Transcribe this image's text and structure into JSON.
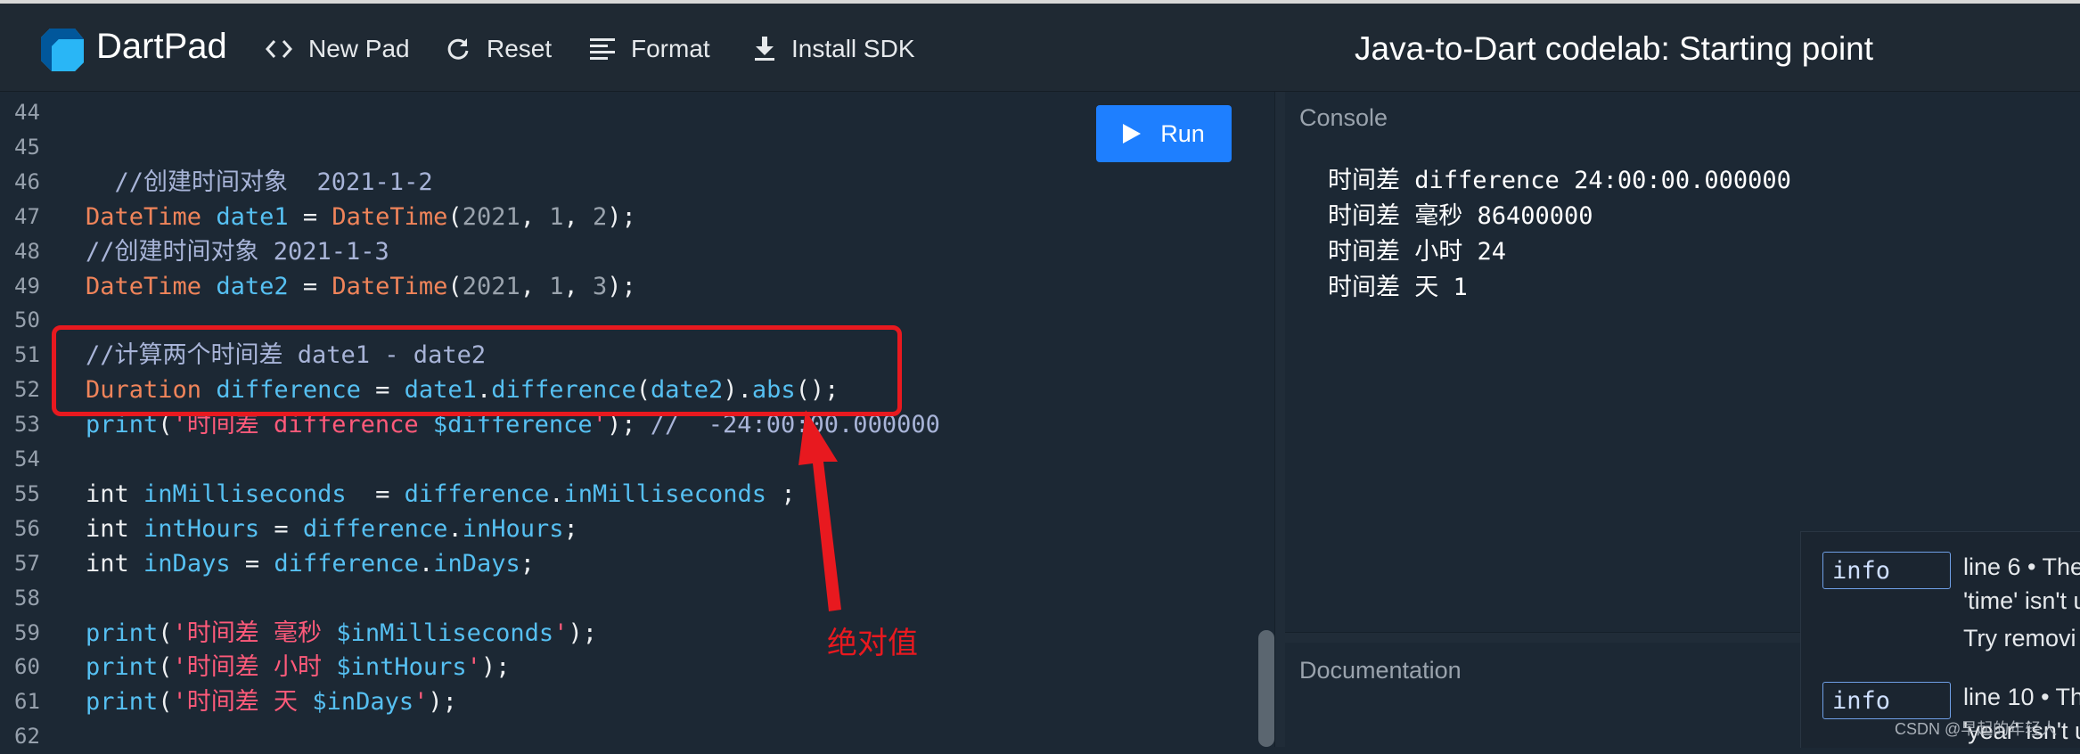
{
  "header": {
    "brand": "DartPad",
    "new_pad_label": "New Pad",
    "reset_label": "Reset",
    "format_label": "Format",
    "install_sdk_label": "Install SDK",
    "pad_title": "Java-to-Dart codelab: Starting point"
  },
  "editor": {
    "run_label": "Run",
    "line_numbers": [
      "44",
      "45",
      "46",
      "47",
      "48",
      "49",
      "50",
      "51",
      "52",
      "53",
      "54",
      "55",
      "56",
      "57",
      "58",
      "59",
      "60",
      "61",
      "62"
    ],
    "lines": [
      [],
      [],
      [
        {
          "t": "  //创建时间对象  2021-1-2",
          "c": "cmt"
        }
      ],
      [
        {
          "t": "DateTime",
          "c": "type"
        },
        {
          "t": " ",
          "c": "plain"
        },
        {
          "t": "date1",
          "c": "ident"
        },
        {
          "t": " = ",
          "c": "plain"
        },
        {
          "t": "DateTime",
          "c": "type"
        },
        {
          "t": "(",
          "c": "plain"
        },
        {
          "t": "2021",
          "c": "num"
        },
        {
          "t": ", ",
          "c": "plain"
        },
        {
          "t": "1",
          "c": "num"
        },
        {
          "t": ", ",
          "c": "plain"
        },
        {
          "t": "2",
          "c": "num"
        },
        {
          "t": ");",
          "c": "plain"
        }
      ],
      [
        {
          "t": "//创建时间对象 2021-1-3",
          "c": "cmt"
        }
      ],
      [
        {
          "t": "DateTime",
          "c": "type"
        },
        {
          "t": " ",
          "c": "plain"
        },
        {
          "t": "date2",
          "c": "ident"
        },
        {
          "t": " = ",
          "c": "plain"
        },
        {
          "t": "DateTime",
          "c": "type"
        },
        {
          "t": "(",
          "c": "plain"
        },
        {
          "t": "2021",
          "c": "num"
        },
        {
          "t": ", ",
          "c": "plain"
        },
        {
          "t": "1",
          "c": "num"
        },
        {
          "t": ", ",
          "c": "plain"
        },
        {
          "t": "3",
          "c": "num"
        },
        {
          "t": ");",
          "c": "plain"
        }
      ],
      [],
      [
        {
          "t": "//计算两个时间差 date1 - date2",
          "c": "cmt"
        }
      ],
      [
        {
          "t": "Duration",
          "c": "type"
        },
        {
          "t": " ",
          "c": "plain"
        },
        {
          "t": "difference",
          "c": "ident"
        },
        {
          "t": " = ",
          "c": "plain"
        },
        {
          "t": "date1",
          "c": "ident"
        },
        {
          "t": ".",
          "c": "plain"
        },
        {
          "t": "difference",
          "c": "ident"
        },
        {
          "t": "(",
          "c": "plain"
        },
        {
          "t": "date2",
          "c": "ident"
        },
        {
          "t": ").",
          "c": "plain"
        },
        {
          "t": "abs",
          "c": "ident"
        },
        {
          "t": "();",
          "c": "plain"
        }
      ],
      [
        {
          "t": "print",
          "c": "ident"
        },
        {
          "t": "(",
          "c": "plain"
        },
        {
          "t": "'时间差 difference ",
          "c": "str"
        },
        {
          "t": "$difference",
          "c": "ident"
        },
        {
          "t": "'",
          "c": "str"
        },
        {
          "t": "); ",
          "c": "plain"
        },
        {
          "t": "//  -24:00:00.000000",
          "c": "cmt"
        }
      ],
      [],
      [
        {
          "t": "int",
          "c": "kw"
        },
        {
          "t": " ",
          "c": "plain"
        },
        {
          "t": "inMilliseconds",
          "c": "ident"
        },
        {
          "t": "  = ",
          "c": "plain"
        },
        {
          "t": "difference",
          "c": "ident"
        },
        {
          "t": ".",
          "c": "plain"
        },
        {
          "t": "inMilliseconds",
          "c": "ident"
        },
        {
          "t": " ;",
          "c": "plain"
        }
      ],
      [
        {
          "t": "int",
          "c": "kw"
        },
        {
          "t": " ",
          "c": "plain"
        },
        {
          "t": "intHours",
          "c": "ident"
        },
        {
          "t": " = ",
          "c": "plain"
        },
        {
          "t": "difference",
          "c": "ident"
        },
        {
          "t": ".",
          "c": "plain"
        },
        {
          "t": "inHours",
          "c": "ident"
        },
        {
          "t": ";",
          "c": "plain"
        }
      ],
      [
        {
          "t": "int",
          "c": "kw"
        },
        {
          "t": " ",
          "c": "plain"
        },
        {
          "t": "inDays",
          "c": "ident"
        },
        {
          "t": " = ",
          "c": "plain"
        },
        {
          "t": "difference",
          "c": "ident"
        },
        {
          "t": ".",
          "c": "plain"
        },
        {
          "t": "inDays",
          "c": "ident"
        },
        {
          "t": ";",
          "c": "plain"
        }
      ],
      [],
      [
        {
          "t": "print",
          "c": "ident"
        },
        {
          "t": "(",
          "c": "plain"
        },
        {
          "t": "'时间差 毫秒 ",
          "c": "str"
        },
        {
          "t": "$inMilliseconds",
          "c": "ident"
        },
        {
          "t": "'",
          "c": "str"
        },
        {
          "t": ");",
          "c": "plain"
        }
      ],
      [
        {
          "t": "print",
          "c": "ident"
        },
        {
          "t": "(",
          "c": "plain"
        },
        {
          "t": "'时间差 小时 ",
          "c": "str"
        },
        {
          "t": "$intHours",
          "c": "ident"
        },
        {
          "t": "'",
          "c": "str"
        },
        {
          "t": ");",
          "c": "plain"
        }
      ],
      [
        {
          "t": "print",
          "c": "ident"
        },
        {
          "t": "(",
          "c": "plain"
        },
        {
          "t": "'时间差 天 ",
          "c": "str"
        },
        {
          "t": "$inDays",
          "c": "ident"
        },
        {
          "t": "'",
          "c": "str"
        },
        {
          "t": ");",
          "c": "plain"
        }
      ],
      []
    ]
  },
  "console": {
    "label": "Console",
    "lines": [
      "时间差 difference 24:00:00.000000",
      "时间差 毫秒 86400000",
      "时间差 小时 24",
      "时间差 天 1"
    ]
  },
  "documentation": {
    "label": "Documentation"
  },
  "issues": [
    {
      "badge": "info",
      "line1": "line 6 • The",
      "line2": "'time' isn't u",
      "line3": "Try removi"
    },
    {
      "badge": "info",
      "line1": "line 10 • Th",
      "line2": "'year' isn't u",
      "line3": ""
    }
  ],
  "annotation": {
    "note": "绝对值",
    "color": "#e8191f"
  },
  "watermark": "CSDN @早起的年轻人",
  "colors": {
    "accent": "#1e7fff",
    "background": "#1c2834",
    "header": "#1f2933"
  }
}
